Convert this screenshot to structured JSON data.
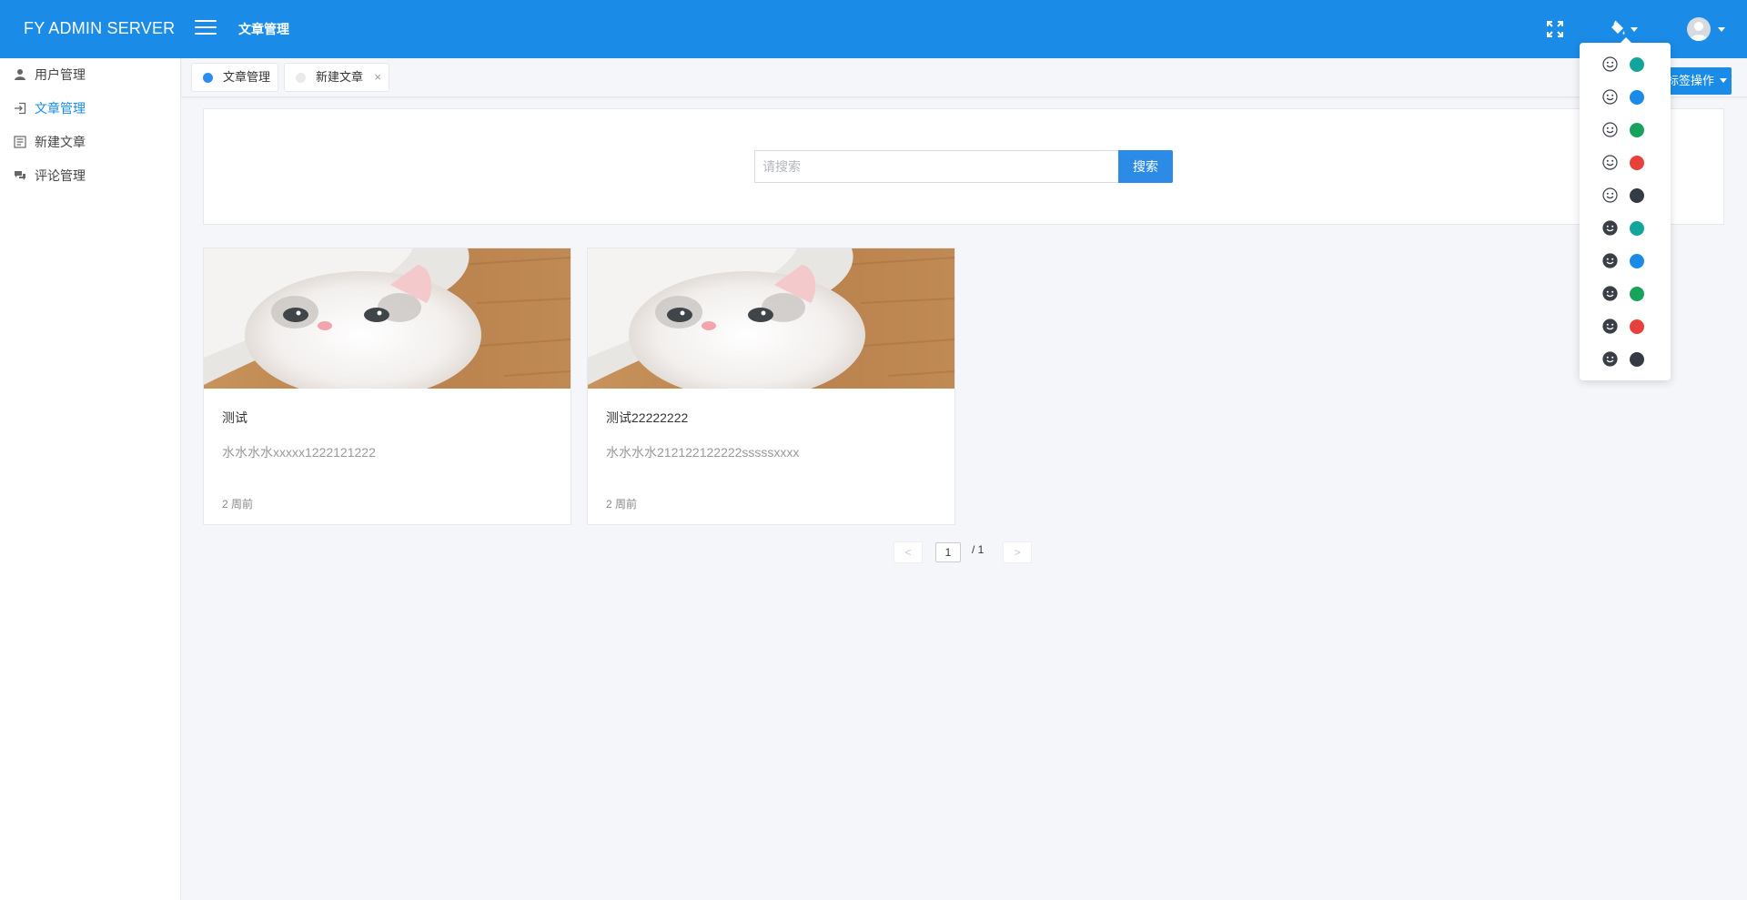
{
  "header": {
    "brand": "FY ADMIN SERVER",
    "title": "文章管理",
    "icons": [
      "menu-icon",
      "fullscreen-icon",
      "paint-bucket-icon",
      "user-avatar-icon"
    ]
  },
  "sidebar": {
    "items": [
      {
        "label": "用户管理",
        "icon": "user-icon",
        "active": false
      },
      {
        "label": "文章管理",
        "icon": "sign-in-icon",
        "active": true
      },
      {
        "label": "新建文章",
        "icon": "list-icon",
        "active": false
      },
      {
        "label": "评论管理",
        "icon": "comments-icon",
        "active": false
      }
    ]
  },
  "tabs": {
    "items": [
      {
        "label": "文章管理",
        "active": true,
        "dot_color": "#2d8cf0"
      },
      {
        "label": "新建文章",
        "active": false,
        "dot_color": "#e8eaec",
        "close": "×"
      }
    ],
    "ops_label": "标签操作"
  },
  "search": {
    "placeholder": "请搜索",
    "value": "",
    "button_label": "搜索"
  },
  "articles": [
    {
      "title": "测试",
      "desc": "水水水水xxxxx1222121222",
      "time": "2 周前",
      "image": "cat-photo"
    },
    {
      "title": "测试22222222",
      "desc": "水水水水212122122222sssssxxxx",
      "time": "2 周前",
      "image": "cat-photo"
    }
  ],
  "pagination": {
    "prev": "<",
    "next": ">",
    "current": "1",
    "total_text": "/  1"
  },
  "theme_menu": {
    "visible": true,
    "options": [
      {
        "style": "light",
        "color": "#13a59b"
      },
      {
        "style": "light",
        "color": "#1a8ce8"
      },
      {
        "style": "light",
        "color": "#17a35b"
      },
      {
        "style": "light",
        "color": "#e8413b"
      },
      {
        "style": "light",
        "color": "#353b45"
      },
      {
        "style": "dark",
        "color": "#13a59b"
      },
      {
        "style": "dark",
        "color": "#1a8ce8"
      },
      {
        "style": "dark",
        "color": "#17a35b"
      },
      {
        "style": "dark",
        "color": "#e8413b"
      },
      {
        "style": "dark",
        "color": "#353b45"
      }
    ]
  },
  "colors": {
    "primary": "#1a8ce8",
    "background": "#f4f6fa"
  }
}
